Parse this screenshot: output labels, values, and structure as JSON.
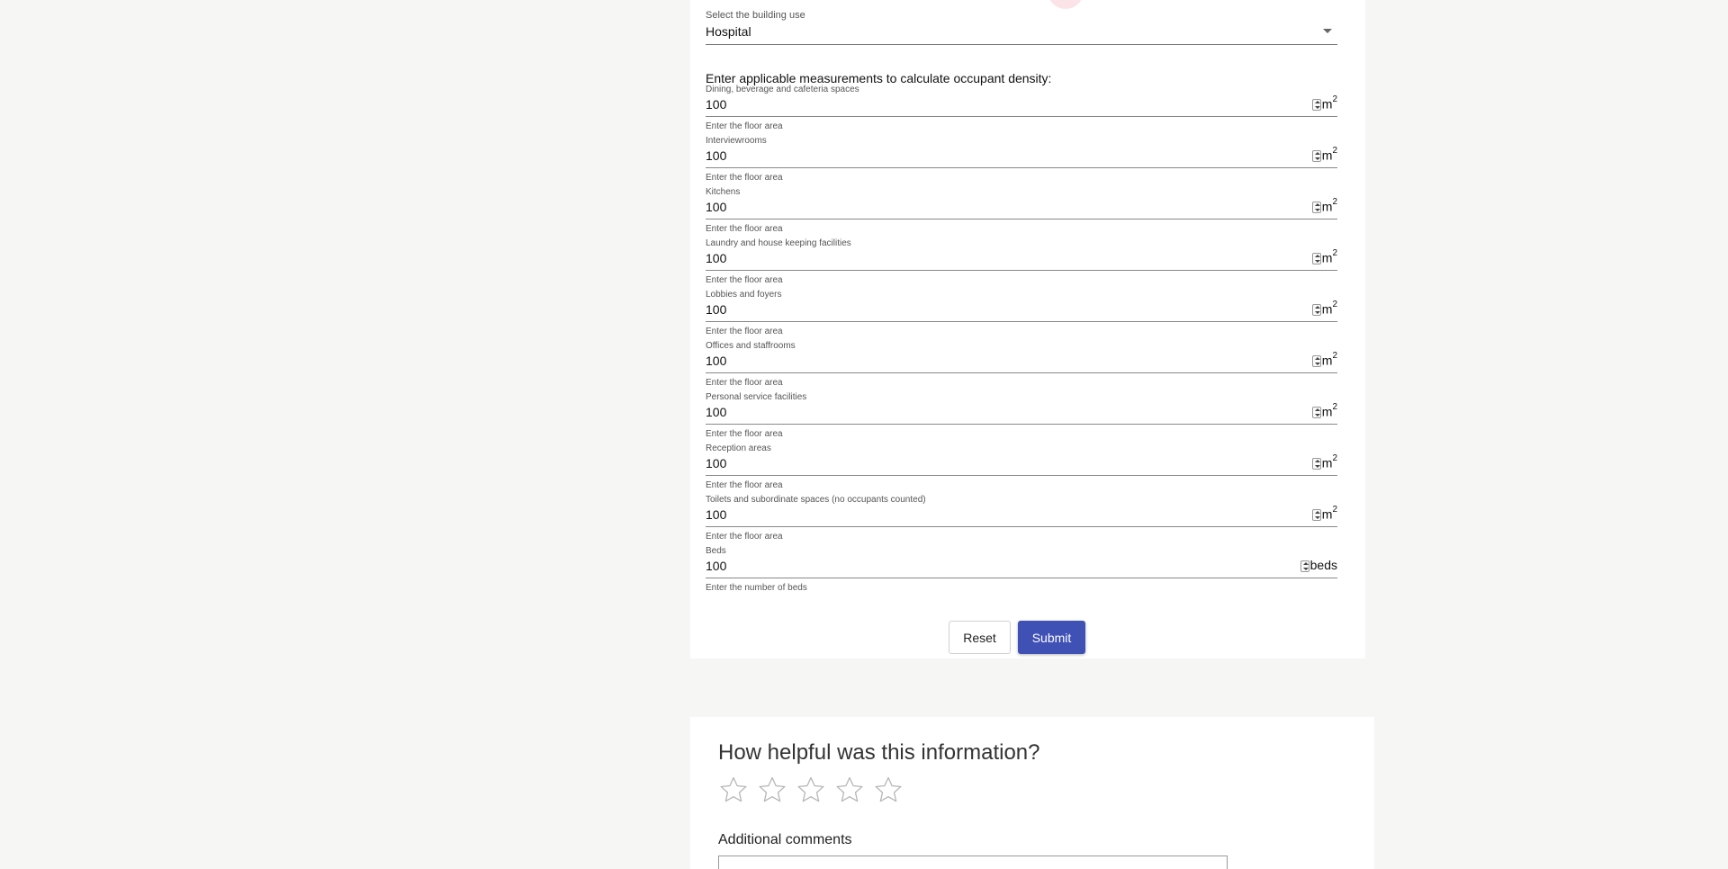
{
  "building_use": {
    "label": "Select the building use",
    "value": "Hospital"
  },
  "intro_text": "Enter applicable measurements to calculate occupant density:",
  "area_helper": "Enter the floor area",
  "fields": [
    {
      "label": "Dining, beverage and cafeteria spaces",
      "value": "100",
      "unit": "m",
      "unit_sup": "2",
      "helper": "Enter the floor area"
    },
    {
      "label": "Interviewrooms",
      "value": "100",
      "unit": "m",
      "unit_sup": "2",
      "helper": "Enter the floor area"
    },
    {
      "label": "Kitchens",
      "value": "100",
      "unit": "m",
      "unit_sup": "2",
      "helper": "Enter the floor area"
    },
    {
      "label": "Laundry and house keeping facilities",
      "value": "100",
      "unit": "m",
      "unit_sup": "2",
      "helper": "Enter the floor area"
    },
    {
      "label": "Lobbies and foyers",
      "value": "100",
      "unit": "m",
      "unit_sup": "2",
      "helper": "Enter the floor area"
    },
    {
      "label": "Offices and staffrooms",
      "value": "100",
      "unit": "m",
      "unit_sup": "2",
      "helper": "Enter the floor area"
    },
    {
      "label": "Personal service facilities",
      "value": "100",
      "unit": "m",
      "unit_sup": "2",
      "helper": "Enter the floor area"
    },
    {
      "label": "Reception areas",
      "value": "100",
      "unit": "m",
      "unit_sup": "2",
      "helper": "Enter the floor area"
    },
    {
      "label": "Toilets and subordinate spaces (no occupants counted)",
      "value": "100",
      "unit": "m",
      "unit_sup": "2",
      "helper": "Enter the floor area"
    },
    {
      "label": "Beds",
      "value": "100",
      "unit": "beds",
      "unit_sup": "",
      "helper": "Enter the number of beds"
    }
  ],
  "buttons": {
    "reset": "Reset",
    "submit": "Submit"
  },
  "feedback": {
    "title": "How helpful was this information?",
    "rating": 0,
    "max_rating": 5,
    "comments_label": "Additional comments"
  },
  "colors": {
    "accent": "#3f51b5",
    "page_bg": "#f6f6f4"
  }
}
